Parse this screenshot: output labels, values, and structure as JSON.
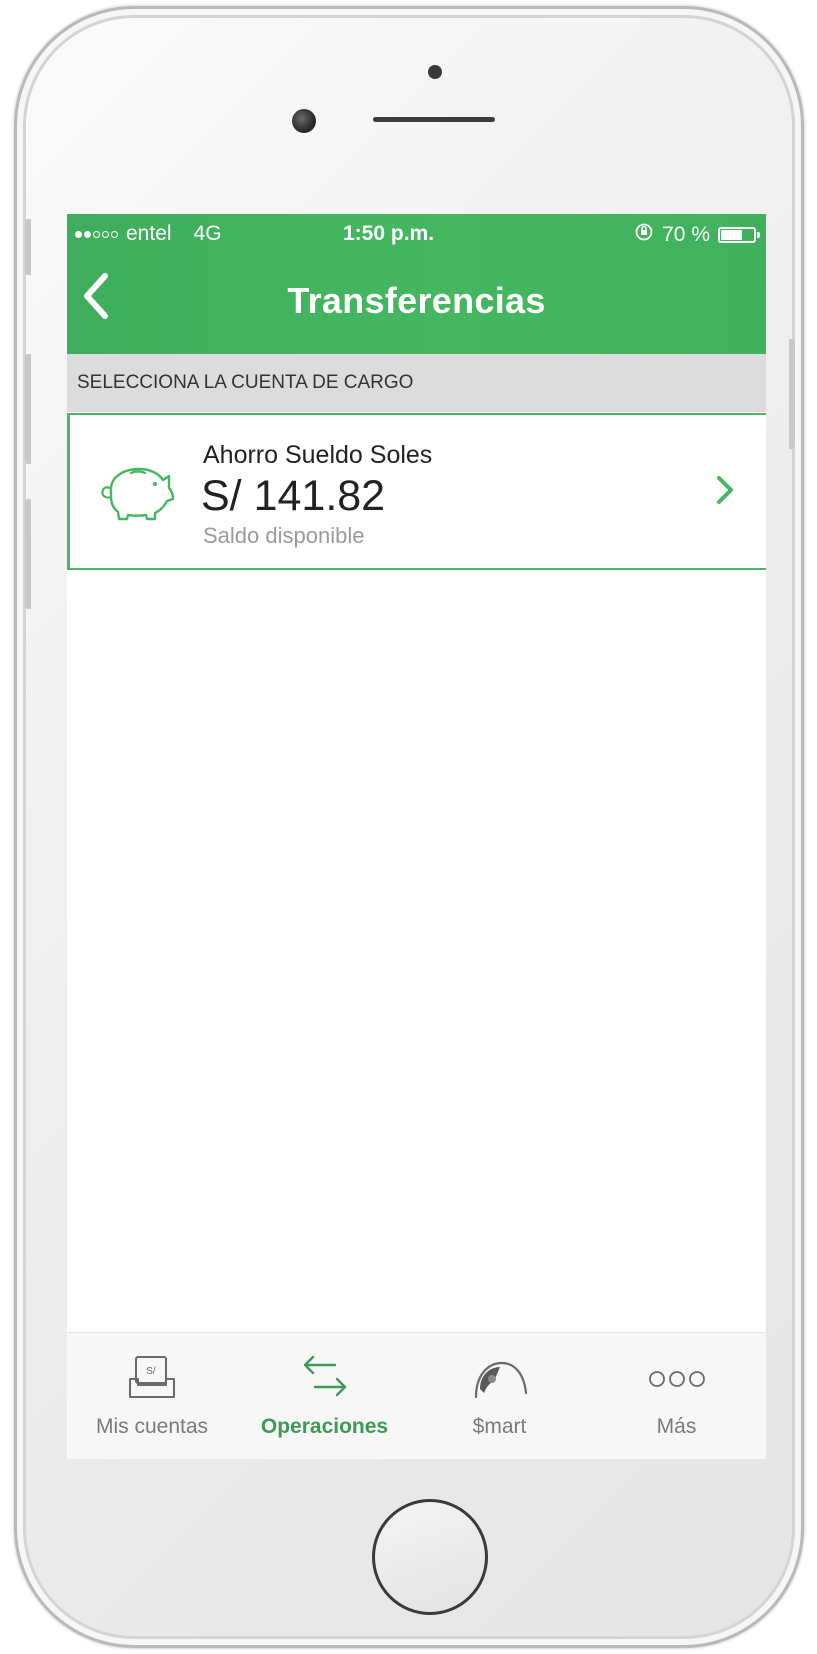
{
  "status_bar": {
    "carrier": "entel",
    "network": "4G",
    "time": "1:50 p.m.",
    "battery_text": "70 %",
    "battery_level": 0.7,
    "signal_bars_filled": 2,
    "signal_bars_total": 5
  },
  "header": {
    "title": "Transferencias",
    "back_icon": "chevron-left-icon"
  },
  "section": {
    "header": "SELECCIONA LA CUENTA DE CARGO"
  },
  "account": {
    "name": "Ahorro Sueldo Soles",
    "balance": "S/ 141.82",
    "caption": "Saldo disponible",
    "icon": "piggy-bank-icon"
  },
  "tabs": [
    {
      "label": "Mis cuentas",
      "icon": "accounts-icon",
      "active": false
    },
    {
      "label": "Operaciones",
      "icon": "transfer-arrows-icon",
      "active": true
    },
    {
      "label": "$mart",
      "icon": "gauge-icon",
      "active": false
    },
    {
      "label": "Más",
      "icon": "more-dots-icon",
      "active": false
    }
  ],
  "colors": {
    "brand_green": "#45b761",
    "active_tab": "#3d9a55",
    "section_bg": "#dcdcdc"
  }
}
